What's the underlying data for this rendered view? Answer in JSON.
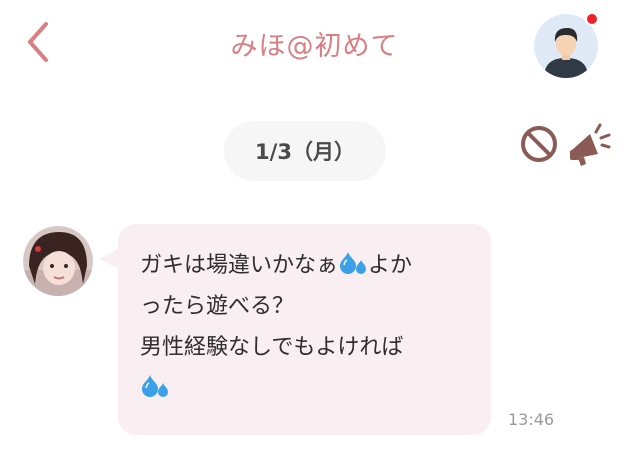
{
  "header": {
    "title": "みほ@初めて",
    "has_unread_notification": true
  },
  "date_separator": "1/3（月）",
  "message": {
    "lines": [
      "ガキは場違いかなぁ",
      "よか",
      "ったら遊べる？",
      "男性経験なしでもよければ"
    ],
    "time": "13:46"
  },
  "colors": {
    "accent": "#d97f84",
    "bubble": "#f9eef1",
    "date_pill": "#f6f6f6",
    "icon_brown": "#8a5a55",
    "notify": "#f2202a",
    "drop": "#3aa0e8"
  },
  "icons": {
    "back": "chevron-left-icon",
    "block": "prohibited-icon",
    "report": "megaphone-icon",
    "emoji": "sweat-droplets-icon"
  }
}
